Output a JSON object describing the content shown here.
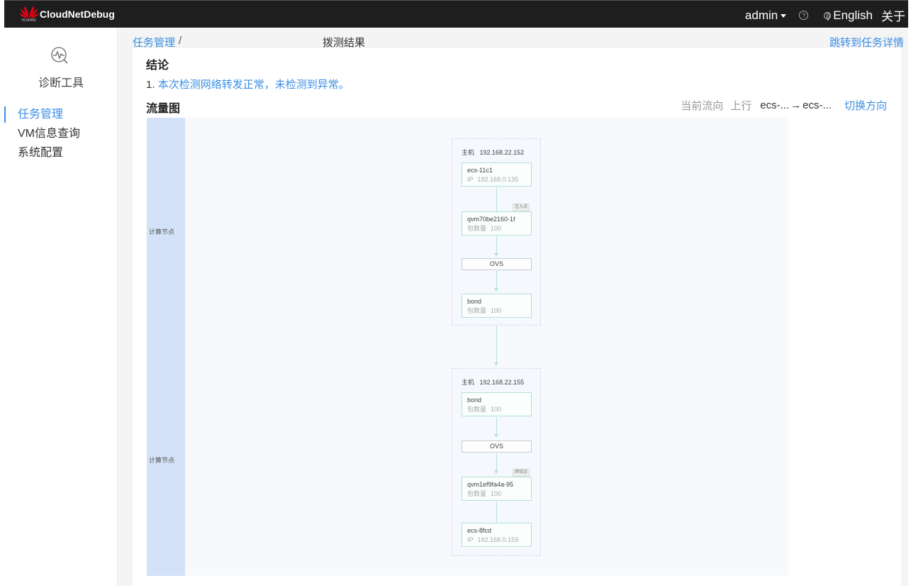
{
  "header": {
    "brand_text": "HUAWEI",
    "app_title": "CloudNetDebug",
    "user": "admin",
    "help_symbol": "?",
    "language": "English",
    "about": "关于"
  },
  "sidebar": {
    "tool_label": "诊断工具",
    "items": [
      {
        "label": "任务管理",
        "active": true
      },
      {
        "label": "VM信息查询"
      },
      {
        "label": "系统配置"
      }
    ]
  },
  "breadcrumb": {
    "parent": "任务管理",
    "separator": "/",
    "current": "拨测结果"
  },
  "jump_link": "跳转到任务详情",
  "conclusion": {
    "title": "结论",
    "number": "1.",
    "text": "本次检测网络转发正常，未检测到异常。"
  },
  "flow": {
    "title": "流量图",
    "current_dir_label": "当前流向",
    "direction": "上行",
    "from": "ecs-...",
    "arrow": "→",
    "to": "ecs-...",
    "switch_label": "切换方向",
    "lanes": [
      "计算节点",
      "计算节点"
    ],
    "hosts": [
      {
        "title": "主机",
        "ip": "192.168.22.152",
        "nodes": [
          {
            "name": "ecs-11c1",
            "sub_label": "IP",
            "sub_value": "192.168.0.135"
          },
          {
            "name": "qvm70be2160-1f",
            "sub_label": "包数量",
            "sub_value": "100",
            "badge": "注入点"
          },
          {
            "ovs": "OVS"
          },
          {
            "name": "bond",
            "sub_label": "包数量",
            "sub_value": "100"
          }
        ]
      },
      {
        "title": "主机",
        "ip": "192.168.22.155",
        "nodes": [
          {
            "name": "bond",
            "sub_label": "包数量",
            "sub_value": "100"
          },
          {
            "ovs": "OVS"
          },
          {
            "name": "qvm1ef9fa4a-95",
            "sub_label": "包数量",
            "sub_value": "100",
            "badge": "终结点"
          },
          {
            "name": "ecs-8fcd",
            "sub_label": "IP",
            "sub_value": "192.168.0.159"
          }
        ]
      }
    ]
  },
  "colors": {
    "accent": "#3a8ee6",
    "topbar": "#1e1e1e",
    "lane": "#d3e2f8",
    "node_border": "#b4e3d8",
    "logo_red": "#e60012"
  }
}
